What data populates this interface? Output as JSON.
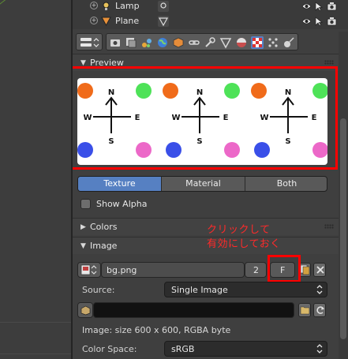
{
  "outliner": {
    "rows": [
      {
        "name": "Lamp"
      },
      {
        "name": "Plane"
      }
    ]
  },
  "tabs": {
    "icons": [
      "render-icon",
      "render-layers-icon",
      "scene-icon",
      "world-icon",
      "object-icon",
      "constraints-icon",
      "modifiers-icon",
      "data-icon",
      "material-icon",
      "texture-icon",
      "particles-icon",
      "physics-icon"
    ],
    "active": "texture-icon"
  },
  "preview": {
    "title": "Preview",
    "compass": {
      "n": "N",
      "s": "S",
      "e": "E",
      "w": "W"
    },
    "dot_colors": {
      "orange": "#f06b1a",
      "green": "#4ee258",
      "blue": "#3a4fe8",
      "pink": "#ec68c8"
    }
  },
  "segmented": {
    "options": [
      "Texture",
      "Material",
      "Both"
    ],
    "active": "Texture"
  },
  "show_alpha": {
    "label": "Show Alpha",
    "checked": false
  },
  "colors_panel": {
    "title": "Colors"
  },
  "image_panel": {
    "title": "Image",
    "image_name": "bg.png",
    "users": "2",
    "fake_user": "F",
    "source_label": "Source:",
    "source_value": "Single Image",
    "info": "Image: size 600 x 600, RGBA byte",
    "color_space_label": "Color Space:",
    "color_space_value": "sRGB"
  },
  "annotation": {
    "line1": "クリックして",
    "line2": "有効にしておく"
  },
  "colors": {
    "accent": "#5680c2",
    "annotation": "#ff0000"
  }
}
